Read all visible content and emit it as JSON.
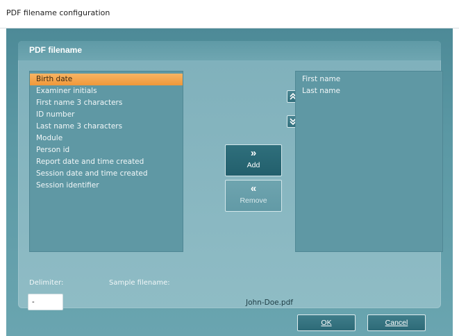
{
  "window": {
    "title": "PDF filename configuration"
  },
  "panel": {
    "title": "PDF filename"
  },
  "available_items": [
    "Birth date",
    "Examiner initials",
    "First name 3 characters",
    "ID number",
    "Last name 3 characters",
    "Module",
    "Person id",
    "Report date and time created",
    "Session date and time created",
    "Session identifier"
  ],
  "selected_available_index": 0,
  "selected_items": [
    "First name",
    "Last name"
  ],
  "buttons": {
    "move_up_icon": "double-chevron-up",
    "move_down_icon": "double-chevron-down",
    "add_glyph": "»",
    "add_label": "Add",
    "remove_glyph": "«",
    "remove_label": "Remove",
    "ok_label": "OK",
    "cancel_label": "Cancel"
  },
  "delimiter": {
    "label": "Delimiter:",
    "value": "-"
  },
  "sample": {
    "label": "Sample filename:",
    "value": "John-Doe.pdf"
  },
  "colors": {
    "selection_highlight": "#f0983a",
    "dialog_background": "#5b98a4",
    "list_background": "#5f98a4"
  }
}
